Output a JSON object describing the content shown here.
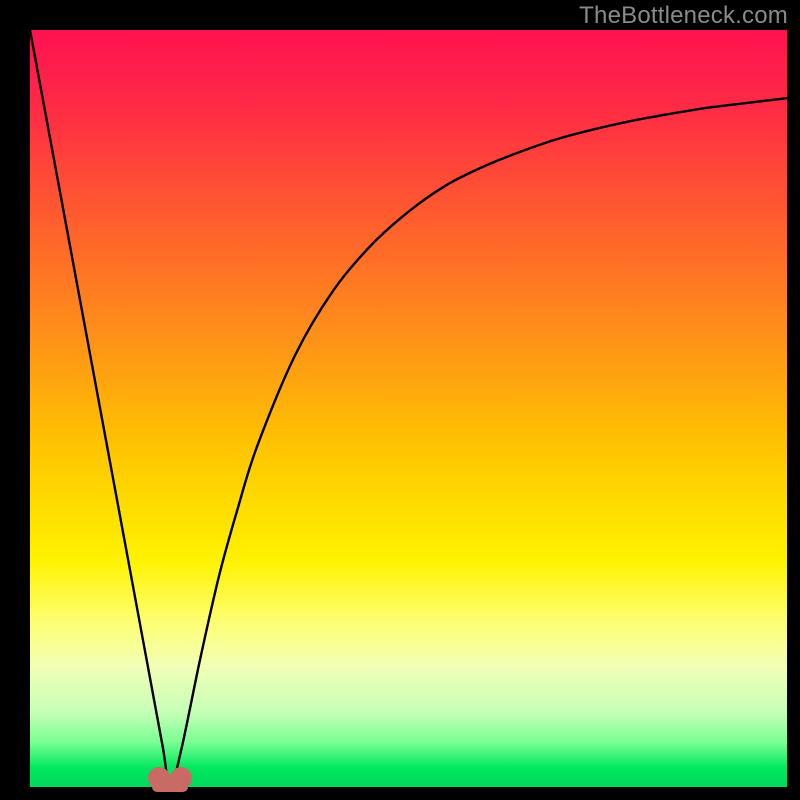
{
  "watermark": {
    "text": "TheBottleneck.com"
  },
  "chart_data": {
    "type": "line",
    "title": "",
    "xlabel": "",
    "ylabel": "",
    "xlim": [
      0,
      100
    ],
    "ylim": [
      0,
      100
    ],
    "grid": false,
    "legend": false,
    "background_gradient": {
      "orientation": "vertical",
      "stops": [
        {
          "pos": 0.0,
          "color": "#ff1250"
        },
        {
          "pos": 0.25,
          "color": "#ff5d2e"
        },
        {
          "pos": 0.55,
          "color": "#ffc400"
        },
        {
          "pos": 0.78,
          "color": "#fdff70"
        },
        {
          "pos": 0.94,
          "color": "#7cff94"
        },
        {
          "pos": 1.0,
          "color": "#00d85a"
        }
      ]
    },
    "series": [
      {
        "name": "bottleneck-curve",
        "x": [
          0,
          2.5,
          5,
          7.5,
          10,
          12.5,
          15,
          17.5,
          18.5,
          20,
          22.5,
          25,
          27.5,
          30,
          35,
          40,
          45,
          50,
          55,
          60,
          65,
          70,
          75,
          80,
          85,
          90,
          95,
          100
        ],
        "values": [
          100,
          86.5,
          73,
          59.5,
          46,
          32.5,
          19,
          5.5,
          0,
          5,
          17,
          28,
          37,
          45,
          57,
          65.5,
          71.5,
          76,
          79.5,
          82,
          84,
          85.7,
          87,
          88.1,
          89,
          89.8,
          90.4,
          91
        ]
      }
    ],
    "annotations": [
      {
        "name": "min-marker",
        "x": 18.5,
        "y": 0,
        "shape": "rounded-dumbbell",
        "color": "#c96a65"
      }
    ]
  },
  "colors": {
    "curve_stroke": "#000000",
    "marker_fill": "#c96a65",
    "frame_border": "#000000"
  }
}
